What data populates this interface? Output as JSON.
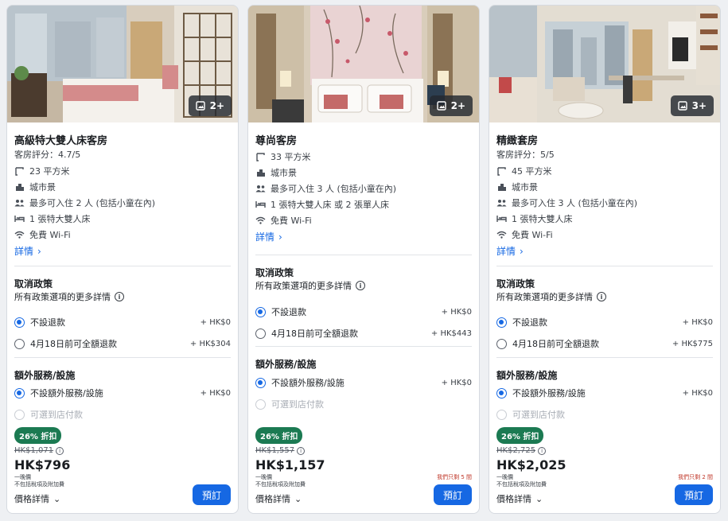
{
  "cards": [
    {
      "photo_count": "2+",
      "title": "高級特大雙人床客房",
      "rating": "客房評分：4.7/5",
      "features": [
        "23 平方米",
        "城市景",
        "最多可入住 2 人 (包括小童在內)",
        "1 張特大雙人床",
        "免費 Wi-Fi"
      ],
      "details_label": "詳情",
      "cancel_title": "取消政策",
      "policy_more": "所有政策選項的更多詳情",
      "cancel_options": [
        {
          "label": "不設退款",
          "price": "+ HK$0",
          "selected": true
        },
        {
          "label": "4月18日前可全額退款",
          "price": "+ HK$304",
          "selected": false
        }
      ],
      "extras_title": "額外服務/設施",
      "extras_options": [
        {
          "label": "不設額外服務/設施",
          "price": "+ HK$0",
          "selected": true
        },
        {
          "label": "可選到店付款",
          "price": "",
          "selected": false,
          "disabled": true
        }
      ],
      "discount_badge": "26% 折扣",
      "old_price": "HK$1,071",
      "price": "HK$796",
      "price_note1": "一晚價",
      "price_note2": "不包括稅項及附加費",
      "left_note": "",
      "price_details": "價格詳情",
      "book_label": "預訂"
    },
    {
      "photo_count": "2+",
      "title": "尊尚客房",
      "rating": "",
      "features": [
        "33 平方米",
        "城市景",
        "最多可入住 3 人 (包括小童在內)",
        "1 張特大雙人床 或 2 張單人床",
        "免費 Wi-Fi"
      ],
      "details_label": "詳情",
      "cancel_title": "取消政策",
      "policy_more": "所有政策選項的更多詳情",
      "cancel_options": [
        {
          "label": "不設退款",
          "price": "+ HK$0",
          "selected": true
        },
        {
          "label": "4月18日前可全額退款",
          "price": "+ HK$443",
          "selected": false
        }
      ],
      "extras_title": "額外服務/設施",
      "extras_options": [
        {
          "label": "不設額外服務/設施",
          "price": "+ HK$0",
          "selected": true
        },
        {
          "label": "可選到店付款",
          "price": "",
          "selected": false,
          "disabled": true
        }
      ],
      "discount_badge": "26% 折扣",
      "old_price": "HK$1,557",
      "price": "HK$1,157",
      "price_note1": "一晚價",
      "price_note2": "不包括稅項及附加費",
      "left_note": "我們只剩 5 間",
      "price_details": "價格詳情",
      "book_label": "預訂"
    },
    {
      "photo_count": "3+",
      "title": "精緻套房",
      "rating": "客房評分：5/5",
      "features": [
        "45 平方米",
        "城市景",
        "最多可入住 3 人 (包括小童在內)",
        "1 張特大雙人床",
        "免費 Wi-Fi"
      ],
      "details_label": "詳情",
      "cancel_title": "取消政策",
      "policy_more": "所有政策選項的更多詳情",
      "cancel_options": [
        {
          "label": "不設退款",
          "price": "+ HK$0",
          "selected": true
        },
        {
          "label": "4月18日前可全額退款",
          "price": "+ HK$775",
          "selected": false
        }
      ],
      "extras_title": "額外服務/設施",
      "extras_options": [
        {
          "label": "不設額外服務/設施",
          "price": "+ HK$0",
          "selected": true
        },
        {
          "label": "可選到店付款",
          "price": "",
          "selected": false,
          "disabled": true
        }
      ],
      "discount_badge": "26% 折扣",
      "old_price": "HK$2,725",
      "price": "HK$2,025",
      "price_note1": "一晚價",
      "price_note2": "不包括稅項及附加費",
      "left_note": "我們只剩 2 間",
      "price_details": "價格詳情",
      "book_label": "預訂"
    }
  ],
  "colors": {
    "accent": "#1668e3",
    "discount": "#1b7a52",
    "left_note": "#c0392b"
  }
}
